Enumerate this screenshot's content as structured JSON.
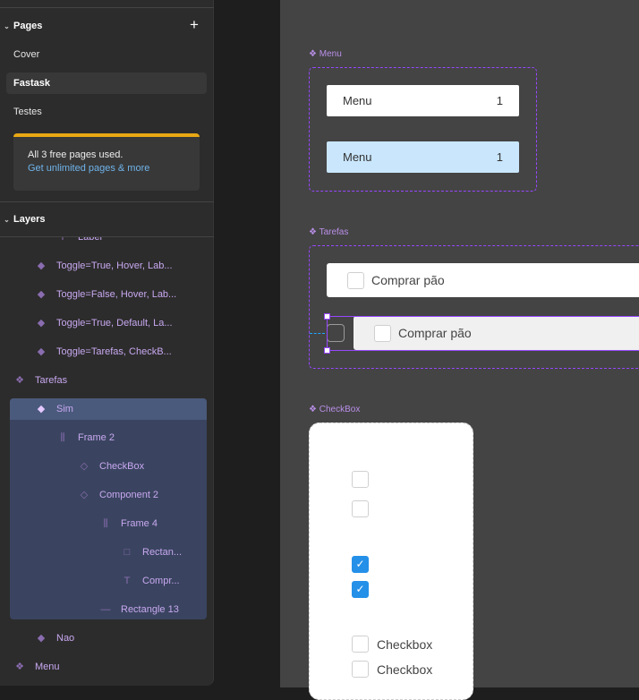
{
  "pages": {
    "title": "Pages",
    "add_icon": "plus-icon",
    "items": [
      {
        "label": "Cover"
      },
      {
        "label": "Fastask",
        "selected": true
      },
      {
        "label": "Testes"
      }
    ],
    "notice": {
      "text": "All 3 free pages used.",
      "link": "Get unlimited pages & more",
      "accent": "#e8a814"
    }
  },
  "layers": {
    "title": "Layers",
    "items": [
      {
        "label": "Label",
        "icon": "text-icon"
      },
      {
        "label": "Toggle=True, Hover, Lab...",
        "icon": "component-instance-icon"
      },
      {
        "label": "Toggle=False, Hover, Lab...",
        "icon": "component-instance-icon"
      },
      {
        "label": "Toggle=True, Default, La...",
        "icon": "component-instance-icon"
      },
      {
        "label": "Toggle=Tarefas, CheckB...",
        "icon": "component-instance-icon"
      },
      {
        "label": "Tarefas",
        "icon": "component-set-icon"
      },
      {
        "label": "Sim",
        "icon": "component-instance-icon",
        "selected": true
      },
      {
        "label": "Frame 2",
        "icon": "auto-layout-icon"
      },
      {
        "label": "CheckBox",
        "icon": "instance-outline-icon"
      },
      {
        "label": "Component 2",
        "icon": "instance-outline-icon"
      },
      {
        "label": "Frame 4",
        "icon": "auto-layout-icon"
      },
      {
        "label": "Rectan...",
        "icon": "rectangle-icon"
      },
      {
        "label": "Compr...",
        "icon": "text-icon"
      },
      {
        "label": "Rectangle 13",
        "icon": "line-icon"
      },
      {
        "label": "Nao",
        "icon": "component-instance-icon"
      },
      {
        "label": "Menu",
        "icon": "component-set-icon"
      }
    ]
  },
  "canvas": {
    "menu": {
      "label": "Menu",
      "buttons": [
        {
          "text": "Menu",
          "count": "1",
          "bg": "#ffffff"
        },
        {
          "text": "Menu",
          "count": "1",
          "bg": "#c9e6fc"
        }
      ]
    },
    "tarefas": {
      "label": "Tarefas",
      "rows": [
        {
          "text": "Comprar pão"
        },
        {
          "text": "Comprar pão"
        }
      ]
    },
    "checkbox": {
      "label": "CheckBox",
      "items": [
        {
          "checked": false
        },
        {
          "checked": false
        },
        {
          "checked": true
        },
        {
          "checked": true
        },
        {
          "checked": false,
          "text": "Checkbox"
        },
        {
          "checked": false,
          "text": "Checkbox"
        }
      ],
      "check_color": "#2490e8"
    }
  }
}
